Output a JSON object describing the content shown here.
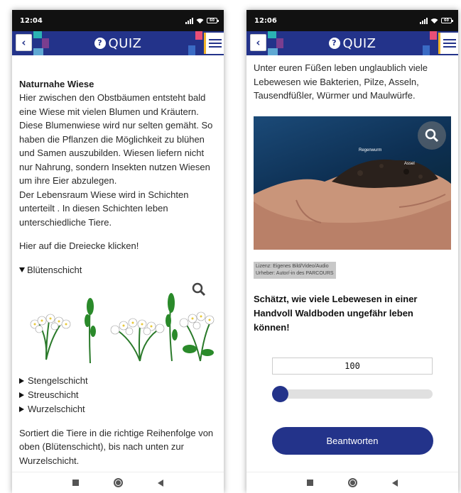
{
  "left": {
    "status_time": "12:04",
    "battery": "60",
    "title": "QUIZ",
    "heading": "Naturnahe Wiese",
    "paragraph1": "Hier zwischen den Obstbäumen entsteht bald eine Wiese mit vielen Blumen und Kräutern. Diese Blumenwiese wird nur selten gemäht. So haben die Pflanzen die Möglichkeit zu blühen und Samen auszubilden. Wiesen liefern nicht nur Nahrung, sondern Insekten nutzen Wiesen um ihre Eier abzulegen.",
    "paragraph2": "Der Lebensraum Wiese wird in Schichten unterteilt . In diesen Schichten leben unterschiedliche Tiere.",
    "instruction": "Hier auf die Dreiecke klicken!",
    "layers": [
      "Blütenschicht",
      "Stengelschicht",
      "Streuschicht",
      "Wurzelschicht"
    ],
    "sort_text": "Sortiert die Tiere in die richtige Reihenfolge von oben (Blütenschicht), bis nach unten zur Wurzelschicht."
  },
  "right": {
    "status_time": "12:06",
    "battery": "60",
    "title": "QUIZ",
    "intro": "Unter euren Füßen leben unglaublich viele Lebewesen wie Bakterien, Pilze, Asseln, Tausendfüßler, Würmer und Maulwürfe.",
    "photo_labels": [
      "Regenwurm",
      "Assel"
    ],
    "license_line1": "Lizenz: Eigenes Bild/Video/Audio",
    "license_line2": "Urheber: Autor/-in des PARCOURS",
    "question": "Schätzt, wie viele Lebewesen in einer Handvoll Waldboden ungefähr leben können!",
    "answer_value": "100",
    "slider_fraction": 0.0,
    "submit_label": "Beantworten"
  },
  "colors": {
    "brand": "#23338a",
    "accent": "#f0b429"
  },
  "icons": {
    "back": "chevron-left-icon",
    "quiz": "question-circle-icon",
    "menu": "hamburger-menu-icon",
    "zoom": "magnifier-icon"
  }
}
